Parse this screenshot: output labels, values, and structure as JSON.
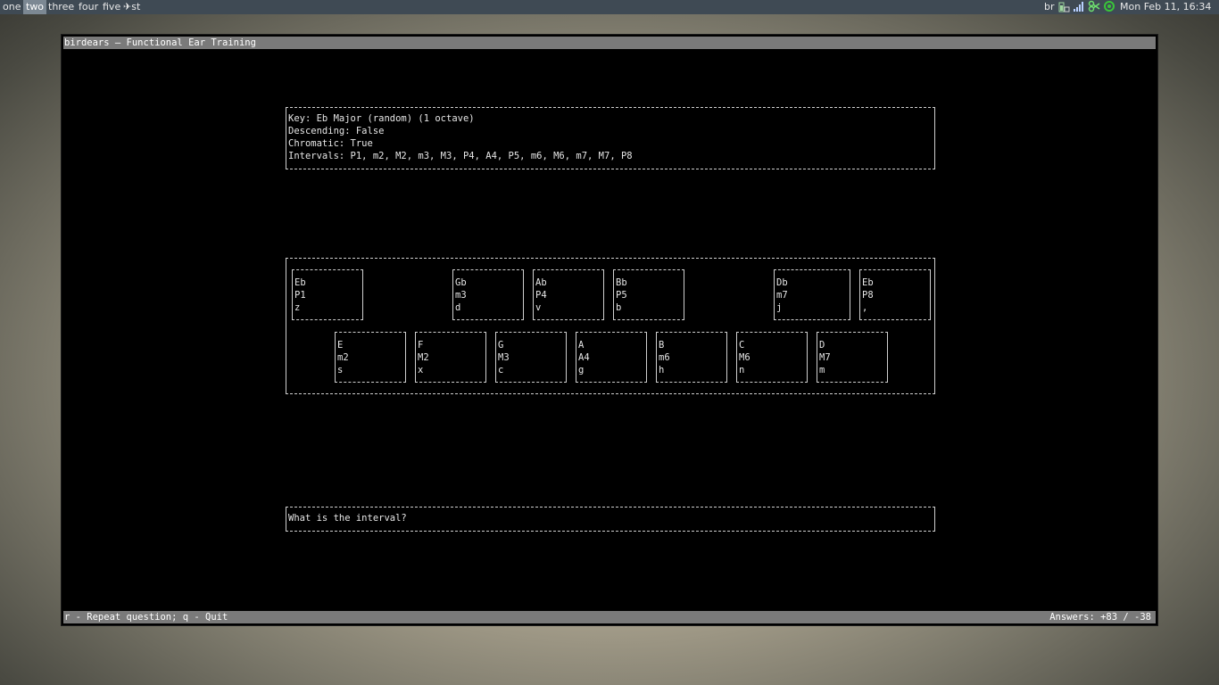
{
  "topbar": {
    "workspaces": [
      {
        "label": "one",
        "active": false
      },
      {
        "label": "two",
        "active": true
      },
      {
        "label": "three",
        "active": false
      },
      {
        "label": "four",
        "active": false
      },
      {
        "label": "five",
        "active": false
      }
    ],
    "window_title": "st",
    "tray_layout": "br",
    "clock": "Mon Feb 11, 16:34"
  },
  "terminal": {
    "title": "birdears — Functional Ear Training",
    "info": {
      "key": "Key: Eb Major (random) (1 octave)",
      "descending": "Descending: False",
      "chromatic": "Chromatic: True",
      "intervals": "Intervals: P1, m2, M2, m3, M3, P4, A4, P5, m6, M6, m7, M7, P8"
    },
    "keyboard": {
      "top_row": [
        {
          "note": "Eb",
          "interval": "P1",
          "key": "z"
        },
        {
          "note": "Gb",
          "interval": "m3",
          "key": "d"
        },
        {
          "note": "Ab",
          "interval": "P4",
          "key": "v"
        },
        {
          "note": "Bb",
          "interval": "P5",
          "key": "b"
        },
        {
          "note": "Db",
          "interval": "m7",
          "key": "j"
        },
        {
          "note": "Eb",
          "interval": "P8",
          "key": ","
        }
      ],
      "bottom_row": [
        {
          "note": "E",
          "interval": "m2",
          "key": "s"
        },
        {
          "note": "F",
          "interval": "M2",
          "key": "x"
        },
        {
          "note": "G",
          "interval": "M3",
          "key": "c"
        },
        {
          "note": "A",
          "interval": "A4",
          "key": "g"
        },
        {
          "note": "B",
          "interval": "m6",
          "key": "h"
        },
        {
          "note": "C",
          "interval": "M6",
          "key": "n"
        },
        {
          "note": "D",
          "interval": "M7",
          "key": "m"
        }
      ]
    },
    "question": "What is the interval?",
    "status_left": "r - Repeat question; q - Quit",
    "status_right": "Answers: +83 / -38"
  }
}
